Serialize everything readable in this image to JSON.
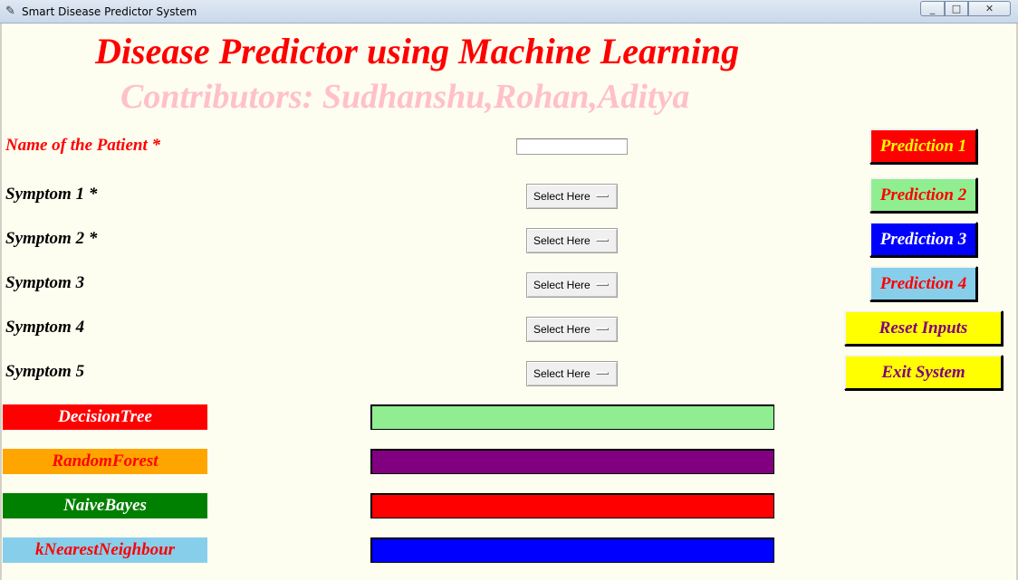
{
  "window": {
    "title": "Smart Disease Predictor System",
    "min": "▭",
    "max": "▭",
    "close": "✕"
  },
  "header": {
    "title": "Disease Predictor using Machine Learning",
    "contributors": "Contributors: Sudhanshu,Rohan,Aditya"
  },
  "patient": {
    "label": "Name of the Patient *",
    "value": ""
  },
  "symptoms": [
    {
      "label": "Symptom 1 *",
      "selected": "Select Here"
    },
    {
      "label": "Symptom 2 *",
      "selected": "Select Here"
    },
    {
      "label": "Symptom 3",
      "selected": "Select Here"
    },
    {
      "label": "Symptom 4",
      "selected": "Select Here"
    },
    {
      "label": "Symptom 5",
      "selected": "Select Here"
    }
  ],
  "buttons": {
    "prediction1": "Prediction 1",
    "prediction2": "Prediction 2",
    "prediction3": "Prediction 3",
    "prediction4": "Prediction 4",
    "reset": "Reset Inputs",
    "exit": "Exit System"
  },
  "models": [
    {
      "name": "DecisionTree",
      "label_bg": "#ff0000",
      "label_fg": "#ffffff",
      "result_bg": "#90ee90",
      "result": ""
    },
    {
      "name": "RandomForest",
      "label_bg": "#ffa500",
      "label_fg": "#ff0000",
      "result_bg": "#800080",
      "result": ""
    },
    {
      "name": "NaiveBayes",
      "label_bg": "#008000",
      "label_fg": "#ffffff",
      "result_bg": "#ff0000",
      "result": ""
    },
    {
      "name": "kNearestNeighbour",
      "label_bg": "#87ceeb",
      "label_fg": "#ff0000",
      "result_bg": "#0000ff",
      "result": ""
    }
  ],
  "colors": {
    "background": "#fefef0",
    "title": "#ff0000",
    "contributors": "#ffc0cb",
    "prediction1_bg": "#ff0000",
    "prediction1_fg": "#ffff00",
    "prediction2_bg": "#90ee90",
    "prediction2_fg": "#ff0000",
    "prediction3_bg": "#0000ff",
    "prediction3_fg": "#ffffff",
    "prediction4_bg": "#87ceeb",
    "prediction4_fg": "#ff0000",
    "reset_bg": "#ffff00",
    "reset_fg": "#800080",
    "exit_bg": "#ffff00",
    "exit_fg": "#800080"
  }
}
